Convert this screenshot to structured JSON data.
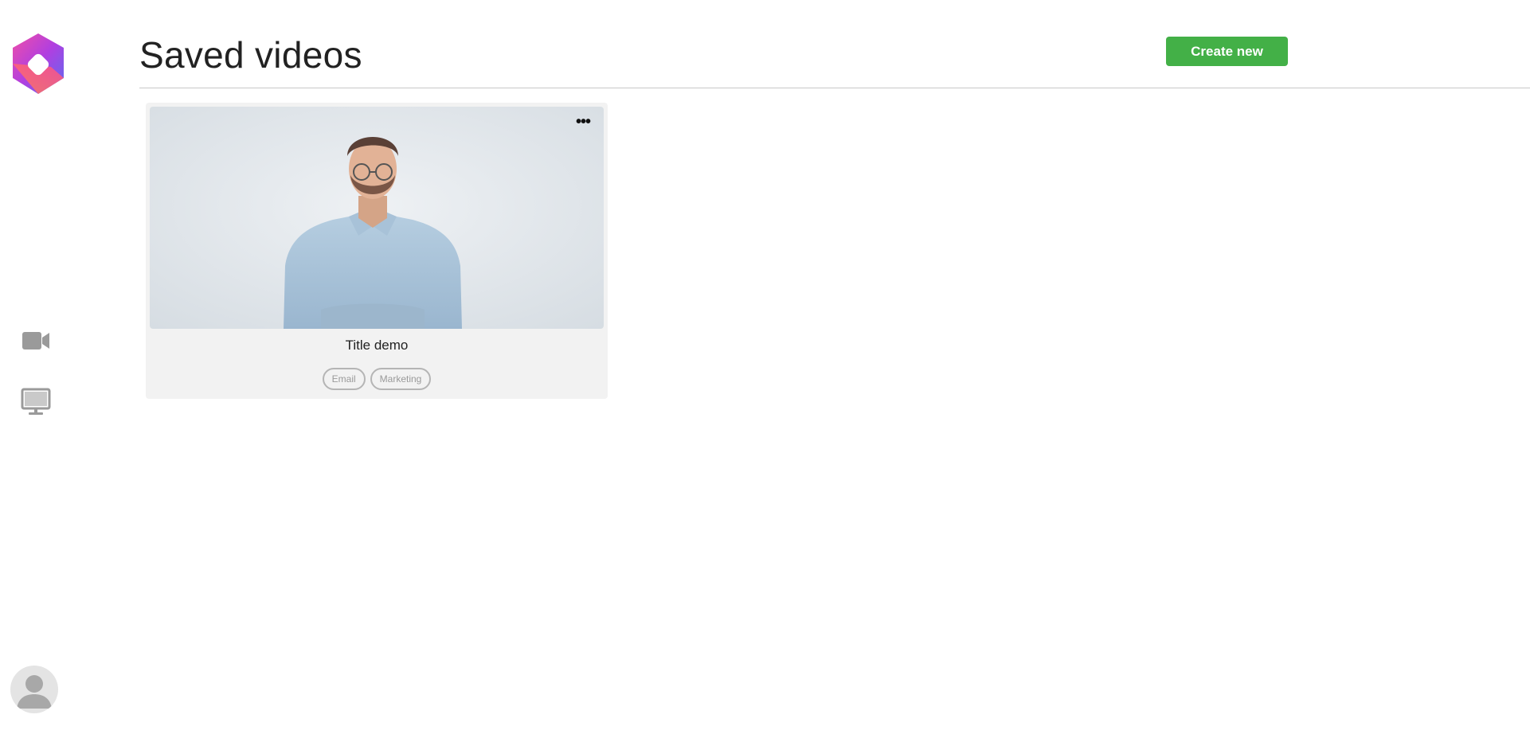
{
  "sidebar": {
    "logo_icon": "app-logo",
    "nav": [
      {
        "icon": "video-camera-icon"
      },
      {
        "icon": "monitor-icon"
      }
    ],
    "user_icon": "user-avatar-icon"
  },
  "header": {
    "title": "Saved videos",
    "create_label": "Create new",
    "accent_color": "#43b047"
  },
  "videos": [
    {
      "title": "Title demo",
      "tags": [
        "Email",
        "Marketing"
      ],
      "menu_icon": "more-horizontal-icon"
    }
  ]
}
